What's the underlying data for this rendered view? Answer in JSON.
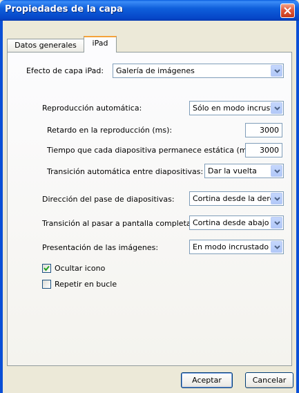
{
  "window": {
    "title": "Propiedades de la capa"
  },
  "tabs": [
    {
      "label": "Datos generales"
    },
    {
      "label": "iPad"
    }
  ],
  "ipad": {
    "effect_label": "Efecto de capa iPad:",
    "effect_value": "Galería de imágenes",
    "autoplay_label": "Reproducción automática:",
    "autoplay_value": "Sólo en modo incrust",
    "delay_label": "Retardo en la reproducción (ms):",
    "delay_value": "3000",
    "static_label": "Tiempo que cada diapositiva permanece estática (ms):",
    "static_value": "3000",
    "transition_label": "Transición automática entre diapositivas:",
    "transition_value": "Dar la vuelta",
    "direction_label": "Dirección del pase de diapositivas:",
    "direction_value": "Cortina desde la dere",
    "fullscreen_label": "Transición al pasar a pantalla completa:",
    "fullscreen_value": "Cortina desde abajo",
    "presentation_label": "Presentación de las imágenes:",
    "presentation_value": "En modo incrustado",
    "hide_icon_label": "Ocultar icono",
    "hide_icon_checked": true,
    "loop_label": "Repetir en bucle",
    "loop_checked": false
  },
  "buttons": {
    "ok": "Aceptar",
    "cancel": "Cancelar"
  }
}
